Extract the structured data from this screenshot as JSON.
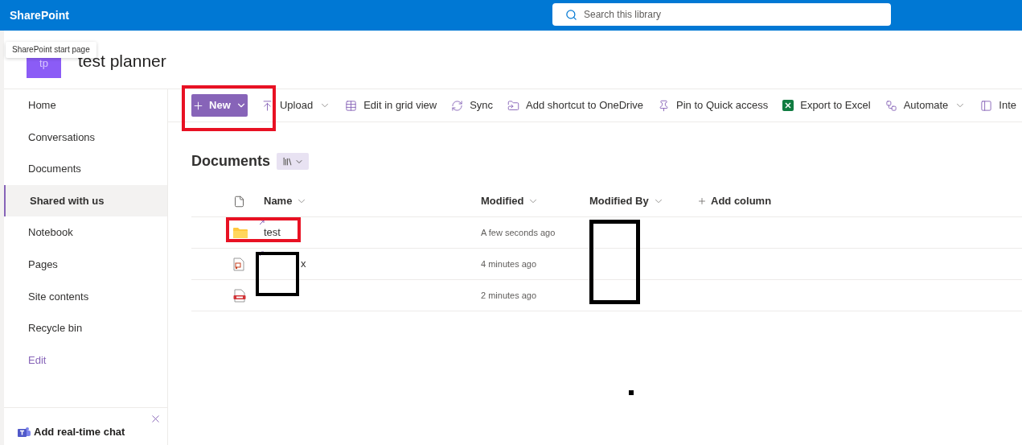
{
  "app_bar": {
    "title": "SharePoint",
    "search": {
      "placeholder": "Search this library"
    }
  },
  "tooltip": "SharePoint start page",
  "site": {
    "logo": "tp",
    "title": "test planner"
  },
  "nav": [
    {
      "label": "Home",
      "selected": false,
      "kind": "link"
    },
    {
      "label": "Conversations",
      "selected": false,
      "kind": "link"
    },
    {
      "label": "Documents",
      "selected": false,
      "kind": "link"
    },
    {
      "label": "Shared with us",
      "selected": true,
      "kind": "link"
    },
    {
      "label": "Notebook",
      "selected": false,
      "kind": "link"
    },
    {
      "label": "Pages",
      "selected": false,
      "kind": "link"
    },
    {
      "label": "Site contents",
      "selected": false,
      "kind": "link"
    },
    {
      "label": "Recycle bin",
      "selected": false,
      "kind": "link"
    },
    {
      "label": "Edit",
      "selected": false,
      "kind": "edit"
    }
  ],
  "chat_panel": {
    "title": "Add real-time chat"
  },
  "command_bar": [
    {
      "label": "New",
      "kind": "new",
      "dropdown": true
    },
    {
      "label": "Upload",
      "kind": "upload",
      "dropdown": true
    },
    {
      "label": "Edit in grid view",
      "kind": "grid",
      "dropdown": false
    },
    {
      "label": "Sync",
      "kind": "sync",
      "dropdown": false
    },
    {
      "label": "Add shortcut to OneDrive",
      "kind": "shortcut",
      "dropdown": false
    },
    {
      "label": "Pin to Quick access",
      "kind": "pin",
      "dropdown": false
    },
    {
      "label": "Export to Excel",
      "kind": "excel",
      "dropdown": false
    },
    {
      "label": "Automate",
      "kind": "automate",
      "dropdown": true
    },
    {
      "label": "Inte",
      "kind": "integrate",
      "dropdown": false
    }
  ],
  "library": {
    "title": "Documents"
  },
  "table": {
    "columns": [
      "Name",
      "Modified",
      "Modified By"
    ],
    "add_column": "Add column",
    "rows": [
      {
        "kind": "folder",
        "name": "test",
        "modified": "A few seconds ago",
        "new": true
      },
      {
        "kind": "pptx",
        "name": "x",
        "modified": "4 minutes ago",
        "new": true
      },
      {
        "kind": "pdf",
        "modified": "2 minutes ago",
        "new": false
      }
    ]
  }
}
